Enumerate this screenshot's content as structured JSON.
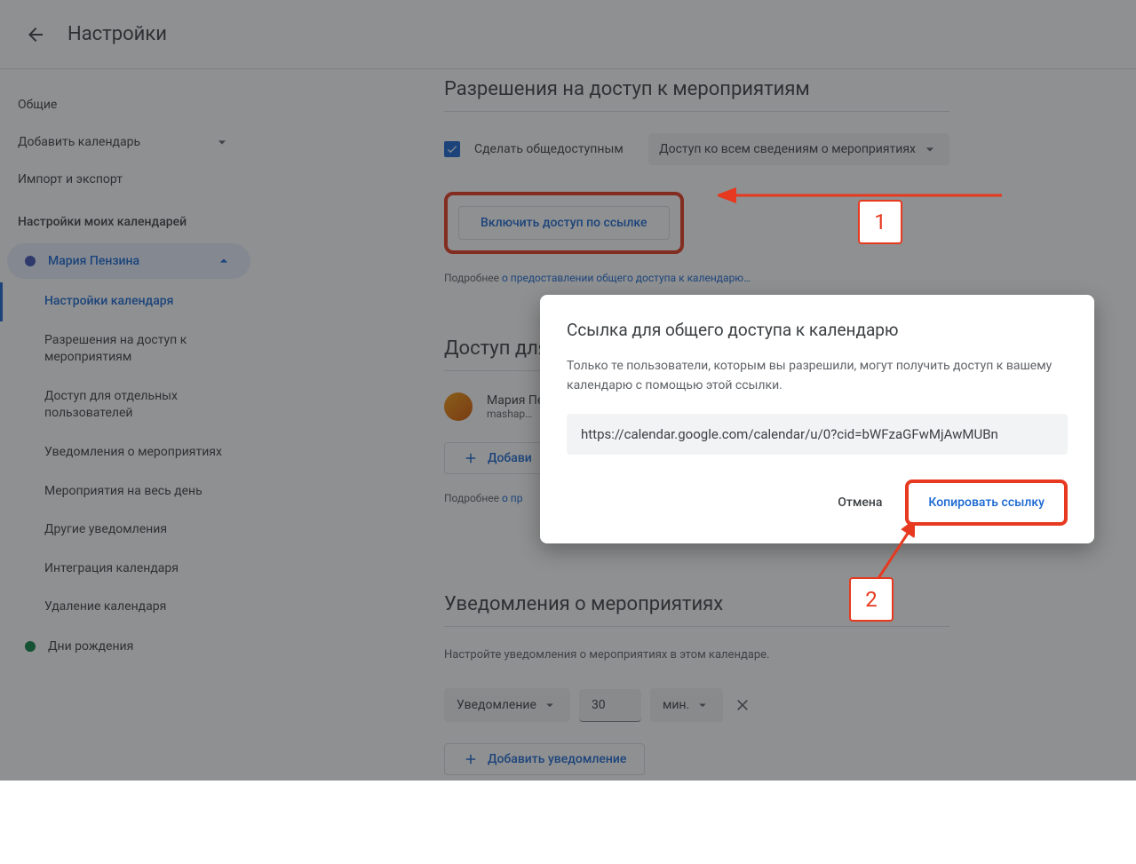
{
  "header": {
    "title": "Настройки"
  },
  "sidebar": {
    "items": [
      "Общие",
      "Добавить календарь",
      "Импорт и экспорт"
    ],
    "section_title": "Настройки моих календарей",
    "calendars": [
      {
        "name": "Мария Пензина",
        "color": "#3f51b5",
        "active": true
      },
      {
        "name": "Дни рождения",
        "color": "#0b8043",
        "active": false
      }
    ],
    "sub_items": [
      "Настройки календаря",
      "Разрешения на доступ к мероприятиям",
      "Доступ для отдельных пользователей",
      "Уведомления о мероприятиях",
      "Мероприятия на весь день",
      "Другие уведомления",
      "Интеграция календаря",
      "Удаление календаря"
    ]
  },
  "permissions": {
    "title": "Разрешения на доступ к мероприятиям",
    "checkbox_label": "Сделать общедоступным",
    "perm_level": "Доступ ко всем сведениям о мероприятиях",
    "link_button": "Включить доступ по ссылке",
    "caption_prefix": "Подробнее ",
    "caption_link": "о предоставлении общего доступа к календарю…"
  },
  "access": {
    "title": "Доступ для отдельных пользователей",
    "user_name": "Мария Пензина",
    "user_email": "mashap…",
    "add_button": "Добавить пользователей",
    "add_button_truncated": "Добави",
    "caption_prefix": "Подробнее ",
    "caption_link": "о пр",
    "caption_link_truncated": "о пр"
  },
  "notifications": {
    "title": "Уведомления о мероприятиях",
    "description": "Настройте уведомления о мероприятиях в этом календаре.",
    "type": "Уведомление",
    "value": "30",
    "unit": "мин.",
    "add_button": "Добавить уведомление"
  },
  "dialog": {
    "title": "Ссылка для общего доступа к календарю",
    "description": "Только те пользователи, которым вы разрешили, могут получить доступ к вашему календарю с помощью этой ссылки.",
    "url": "https://calendar.google.com/calendar/u/0?cid=bWFzaGFwMjAwMUBn",
    "cancel": "Отмена",
    "copy": "Копировать ссылку"
  },
  "annotations": {
    "box1": "1",
    "box2": "2"
  }
}
